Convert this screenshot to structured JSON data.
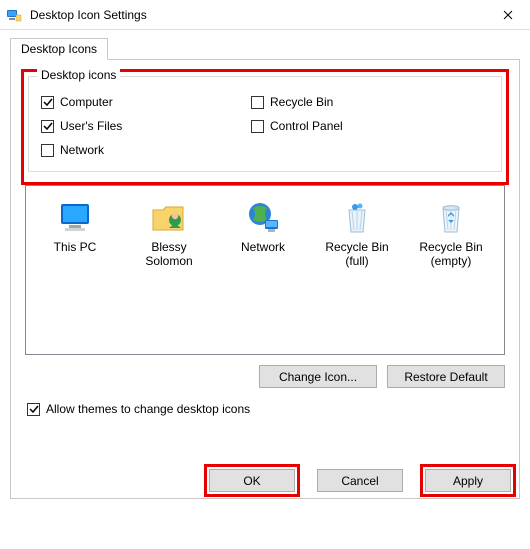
{
  "window": {
    "title": "Desktop Icon Settings"
  },
  "tab": {
    "label": "Desktop Icons"
  },
  "group": {
    "title": "Desktop icons",
    "items": {
      "computer": {
        "label": "Computer",
        "checked": true
      },
      "users_files": {
        "label": "User's Files",
        "checked": true
      },
      "network": {
        "label": "Network",
        "checked": false
      },
      "recycle_bin": {
        "label": "Recycle Bin",
        "checked": false
      },
      "control_panel": {
        "label": "Control Panel",
        "checked": false
      }
    }
  },
  "preview": {
    "items": [
      {
        "label": "This PC",
        "icon": "monitor"
      },
      {
        "label": "Blessy Solomon",
        "icon": "user-folder"
      },
      {
        "label": "Network",
        "icon": "globe"
      },
      {
        "label": "Recycle Bin (full)",
        "icon": "bin-full"
      },
      {
        "label": "Recycle Bin (empty)",
        "icon": "bin-empty"
      }
    ]
  },
  "buttons": {
    "change_icon": "Change Icon...",
    "restore_default": "Restore Default",
    "ok": "OK",
    "cancel": "Cancel",
    "apply": "Apply"
  },
  "allow_themes": {
    "label": "Allow themes to change desktop icons",
    "checked": true
  }
}
